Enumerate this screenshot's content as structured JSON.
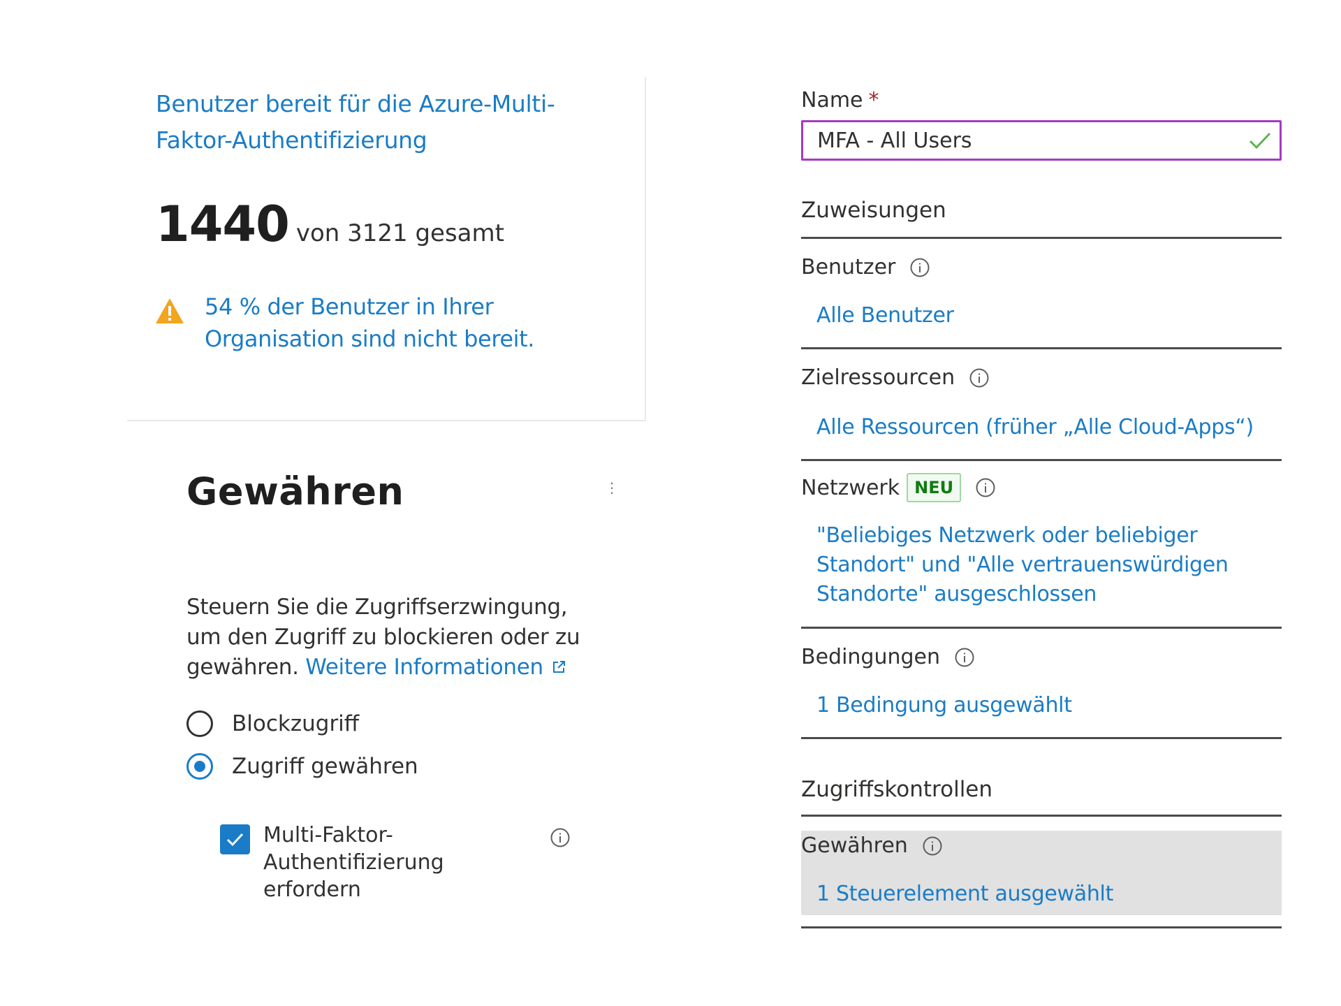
{
  "readiness": {
    "title": "Benutzer bereit für die Azure-Multi-Faktor-Authentifizierung",
    "count": "1440",
    "total_text": "von 3121 gesamt",
    "warning": "54 % der Benutzer in Ihrer Organisation sind nicht bereit.",
    "warning_icon": "warning-triangle-icon"
  },
  "grant_panel": {
    "heading": "Gewähren",
    "more_icon": "⋮",
    "description": "Steuern Sie die Zugriffserzwingung, um den Zugriff zu blockieren oder zu gewähren.",
    "learn_more": "Weitere Informationen",
    "options": [
      {
        "label": "Blockzugriff",
        "selected": false
      },
      {
        "label": "Zugriff gewähren",
        "selected": true
      }
    ],
    "mfa_checkbox": {
      "label": "Multi-Faktor-Authentifizierung erfordern",
      "checked": true
    }
  },
  "policy": {
    "name_label": "Name",
    "required_mark": "*",
    "name_value": "MFA - All Users",
    "assignments_heading": "Zuweisungen",
    "users_label": "Benutzer",
    "users_value": "Alle Benutzer",
    "targets_label": "Zielressourcen",
    "targets_value": "Alle Ressourcen (früher „Alle Cloud-Apps“)",
    "network_label": "Netzwerk",
    "network_badge": "NEU",
    "network_value": "\"Beliebiges Netzwerk oder beliebiger Standort\" und \"Alle vertrauenswürdigen Standorte\" ausgeschlossen",
    "conditions_label": "Bedingungen",
    "conditions_value": "1 Bedingung ausgewählt",
    "access_controls_heading": "Zugriffskontrollen",
    "grant_label": "Gewähren",
    "grant_value": "1 Steuerelement ausgewählt"
  },
  "colors": {
    "link": "#1a7cc6",
    "input_border": "#a33bc1",
    "valid_check": "#5fb34f",
    "warning": "#f2a51d",
    "badge_green": "#107c10",
    "selected_row": "#e1e1e1"
  }
}
